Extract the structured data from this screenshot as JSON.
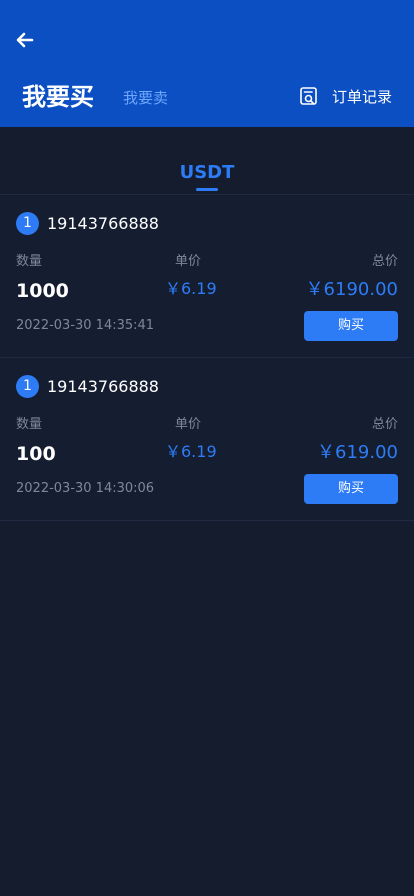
{
  "header": {
    "back_icon": "back-arrow-icon",
    "title": "我要买",
    "subtitle": "我要卖",
    "order_icon": "order-record-icon",
    "order_label": "订单记录"
  },
  "tabs": [
    {
      "label": "USDT",
      "active": true
    }
  ],
  "labels": {
    "quantity": "数量",
    "unit_price": "单价",
    "total_price": "总价",
    "buy": "购买"
  },
  "listings": [
    {
      "rank": "1",
      "phone": "19143766888",
      "quantity": "1000",
      "unit_price": "￥6.19",
      "total": "￥6190.00",
      "date": "2022-03-30 14:35:41"
    },
    {
      "rank": "1",
      "phone": "19143766888",
      "quantity": "100",
      "unit_price": "￥6.19",
      "total": "￥619.00",
      "date": "2022-03-30 14:30:06"
    }
  ],
  "colors": {
    "header_bg": "#0b4fc2",
    "page_bg": "#141c2e",
    "accent": "#2d7cf6",
    "muted_text": "#7e879b"
  }
}
